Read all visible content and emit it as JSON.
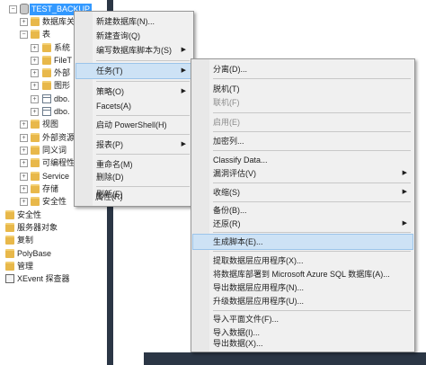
{
  "tree": {
    "items": [
      {
        "label": "TEST_BACKUP",
        "expander": "−",
        "icon": "database-icon",
        "selected": true
      },
      {
        "label": "数据库关",
        "expander": "+",
        "icon": "folder-icon"
      },
      {
        "label": "表",
        "expander": "−",
        "icon": "folder-icon"
      },
      {
        "label": "系统",
        "expander": "+",
        "icon": "folder-icon"
      },
      {
        "label": "FileT",
        "expander": "+",
        "icon": "folder-icon"
      },
      {
        "label": "外部",
        "expander": "+",
        "icon": "folder-icon"
      },
      {
        "label": "图形",
        "expander": "+",
        "icon": "folder-icon"
      },
      {
        "label": "dbo.",
        "expander": "+",
        "icon": "table-icon"
      },
      {
        "label": "dbo.",
        "expander": "+",
        "icon": "table-icon"
      },
      {
        "label": "视图",
        "expander": "+",
        "icon": "folder-icon"
      },
      {
        "label": "外部资源",
        "expander": "+",
        "icon": "folder-icon"
      },
      {
        "label": "同义词",
        "expander": "+",
        "icon": "folder-icon"
      },
      {
        "label": "可编程性",
        "expander": "+",
        "icon": "folder-icon"
      },
      {
        "label": "Service",
        "expander": "+",
        "icon": "folder-icon"
      },
      {
        "label": "存储",
        "expander": "+",
        "icon": "folder-icon"
      },
      {
        "label": "安全性",
        "expander": "+",
        "icon": "folder-icon"
      },
      {
        "label": "安全性",
        "expander": "",
        "icon": "folder-icon"
      },
      {
        "label": "服务器对象",
        "expander": "",
        "icon": "folder-icon"
      },
      {
        "label": "复制",
        "expander": "",
        "icon": "folder-icon"
      },
      {
        "label": "PolyBase",
        "expander": "",
        "icon": "folder-icon"
      },
      {
        "label": "管理",
        "expander": "",
        "icon": "folder-icon"
      },
      {
        "label": "XEvent 探查器",
        "expander": "",
        "icon": "xevent-icon"
      }
    ]
  },
  "menu1": {
    "items": [
      {
        "label": "新建数据库(N)..."
      },
      {
        "label": "新建查询(Q)"
      },
      {
        "label": "编写数据库脚本为(S)",
        "submenu": true
      },
      {
        "label": "任务(T)",
        "submenu": true,
        "highlight": true
      },
      {
        "label": "策略(O)",
        "submenu": true
      },
      {
        "label": "Facets(A)"
      },
      {
        "label": "启动 PowerShell(H)"
      },
      {
        "label": "报表(P)",
        "submenu": true
      },
      {
        "label": "重命名(M)"
      },
      {
        "label": "删除(D)"
      },
      {
        "label": "刷新(F)"
      },
      {
        "label": "属性(R)"
      }
    ]
  },
  "menu2": {
    "items": [
      {
        "label": "分离(D)..."
      },
      {
        "label": "脱机(T)"
      },
      {
        "label": "联机(F)",
        "disabled": true
      },
      {
        "label": "启用(E)",
        "disabled": true
      },
      {
        "label": "加密列..."
      },
      {
        "label": "Classify Data..."
      },
      {
        "label": "漏洞评估(V)",
        "submenu": true
      },
      {
        "label": "收缩(S)",
        "submenu": true
      },
      {
        "label": "备份(B)..."
      },
      {
        "label": "还原(R)",
        "submenu": true
      },
      {
        "label": "生成脚本(E)...",
        "highlight": true
      },
      {
        "label": "提取数据层应用程序(X)..."
      },
      {
        "label": "将数据库部署到 Microsoft Azure SQL 数据库(A)..."
      },
      {
        "label": "导出数据层应用程序(N)..."
      },
      {
        "label": "升级数据层应用程序(U)..."
      },
      {
        "label": "导入平面文件(F)..."
      },
      {
        "label": "导入数据(I)..."
      },
      {
        "label": "导出数据(X)..."
      }
    ]
  }
}
